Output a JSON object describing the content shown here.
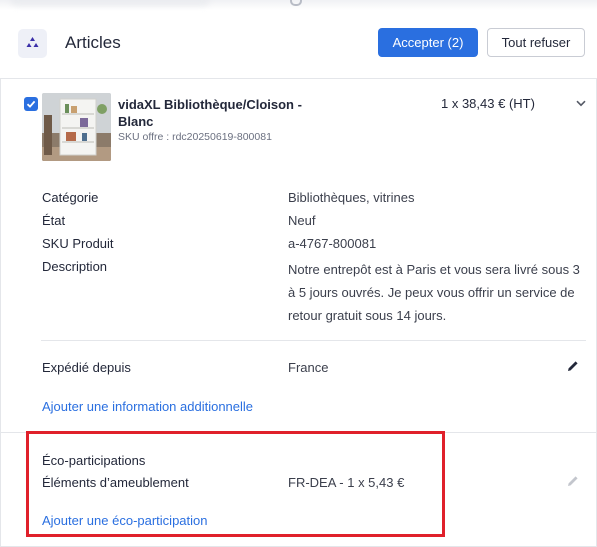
{
  "header": {
    "title": "Articles",
    "accept_label": "Accepter (2)",
    "refuse_label": "Tout refuser"
  },
  "product": {
    "name": "vidaXL Bibliothèque/Cloison - Blanc",
    "sku_offer": "SKU offre : rdc20250619-800081",
    "price": "1 x 38,43 € (HT)",
    "checked": true
  },
  "details": [
    {
      "label": "Catégorie",
      "value": "Bibliothèques, vitrines"
    },
    {
      "label": "État",
      "value": "Neuf"
    },
    {
      "label": "SKU Produit",
      "value": "a-4767-800081"
    },
    {
      "label": "Description",
      "value": "Notre entrepôt est à Paris et vous sera livré sous 3 à 5 jours ouvrés. Je peux vous offrir un service de retour gratuit sous 14 jours."
    }
  ],
  "shipping": {
    "label": "Expédié depuis",
    "value": "France",
    "add_info_link": "Ajouter une information additionnelle"
  },
  "eco": {
    "heading": "Éco-participations",
    "label": "Éléments d’ameublement",
    "value": "FR-DEA - 1 x 5,43 €",
    "add_link": "Ajouter une éco-participation"
  },
  "colors": {
    "accent": "#2a6fe0",
    "highlight": "#e0202a"
  },
  "icons": {
    "header": "cube-cluster-icon",
    "edit": "pencil-icon",
    "expand": "chevron-down-icon",
    "check": "check-icon"
  }
}
